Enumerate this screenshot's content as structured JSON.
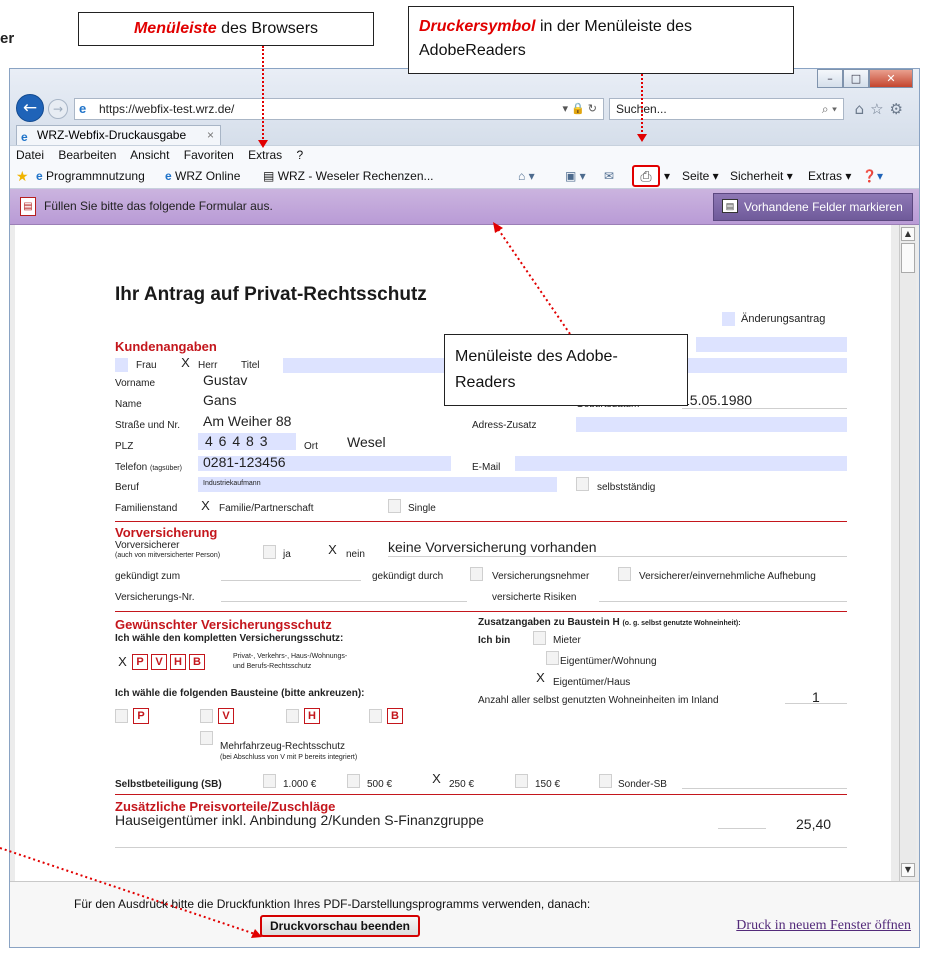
{
  "edge_text": "er",
  "callouts": {
    "browser_menu_em": "Menüleiste",
    "browser_menu_rest": " des Browsers",
    "printer_em": "Druckersymbol",
    "printer_rest": " in der Menüleiste des AdobeReaders",
    "adobe_menu": "Menüleiste des Adobe-Readers"
  },
  "browser": {
    "url": "https://webfix-test.wrz.de/",
    "search_placeholder": "Suchen...",
    "tab_title": "WRZ-Webfix-Druckausgabe",
    "menu": [
      "Datei",
      "Bearbeiten",
      "Ansicht",
      "Favoriten",
      "Extras",
      "?"
    ],
    "favorites": [
      "Programmnutzung",
      "WRZ Online",
      "WRZ - Weseler Rechenzen..."
    ],
    "commands": {
      "seite": "Seite ▾",
      "sicherheit": "Sicherheit ▾",
      "extras": "Extras ▾"
    }
  },
  "adobe": {
    "message": "Füllen Sie bitte das folgende Formular aus.",
    "highlight_button": "Vorhandene Felder markieren"
  },
  "form": {
    "title": "Ihr Antrag auf Privat-Rechtsschutz",
    "aenderungsantrag": "Änderungsantrag",
    "kunden": {
      "heading": "Kundenangaben",
      "frau": "Frau",
      "herr": "Herr",
      "titel": "Titel",
      "vorname_label": "Vorname",
      "vorname": "Gustav",
      "name_label": "Name",
      "name": "Gans",
      "geburtsdatum_label": "Geburtsdatum",
      "geburtsdatum": "15.05.1980",
      "strasse_label": "Straße und Nr.",
      "strasse": "Am Weiher 88",
      "adresszusatz_label": "Adress-Zusatz",
      "plz_label": "PLZ",
      "plz": "4 6 4 8 3",
      "ort_label": "Ort",
      "ort": "Wesel",
      "telefon_label": "Telefon",
      "telefon_suffix": "(tagsüber)",
      "telefon": "0281-123456",
      "email_label": "E-Mail",
      "beruf_label": "Beruf",
      "beruf": "Industriekaufmann",
      "selbststaendig": "selbstständig",
      "familienstand_label": "Familienstand",
      "familie": "Familie/Partnerschaft",
      "single": "Single"
    },
    "vorvers": {
      "heading": "Vorversicherung",
      "vorversicherer": "Vorversicherer",
      "vorversicherer_sub": "(auch von mitversicherter Person)",
      "ja": "ja",
      "nein": "nein",
      "text": "keine Vorversicherung vorhanden",
      "gekuendigt_zum": "gekündigt zum",
      "gekuendigt_durch": "gekündigt durch",
      "versicherungsnehmer": "Versicherungsnehmer",
      "versicherer_aufhebung": "Versicherer/einvernehmliche Aufhebung",
      "versnr": "Versicherungs-Nr.",
      "risiken": "versicherte Risiken"
    },
    "schutz": {
      "heading": "Gewünschter Versicherungsschutz",
      "komplett": "Ich wähle den kompletten Versicherungsschutz:",
      "badges": [
        "P",
        "V",
        "H",
        "B"
      ],
      "komplett_desc1": "Privat-, Verkehrs-, Haus-/Wohnungs-",
      "komplett_desc2": "und Berufs-Rechtsschutz",
      "bausteine": "Ich wähle die folgenden Bausteine (bitte ankreuzen):",
      "mehrfahrzeug": "Mehrfahrzeug-Rechtsschutz",
      "mehrfahrzeug_sub": "(bei Abschluss von V mit P bereits integriert)",
      "zusatz_heading": "Zusatzangaben zu Baustein H",
      "zusatz_sub": "(o. g. selbst genutzte Wohneinheit):",
      "ich_bin": "Ich bin",
      "mieter": "Mieter",
      "eig_wohnung": "Eigentümer/Wohnung",
      "eig_haus": "Eigentümer/Haus",
      "anzahl_label": "Anzahl aller selbst genutzten Wohneinheiten im Inland",
      "anzahl": "1",
      "sb_label": "Selbstbeteiligung (SB)",
      "sb_options": [
        "1.000 €",
        "500 €",
        "250 €",
        "150 €",
        "Sonder-SB"
      ]
    },
    "preis": {
      "heading": "Zusätzliche Preisvorteile/Zuschläge",
      "text": "Hauseigentümer inkl. Anbindung 2/Kunden S-Finanzgruppe",
      "value": "25,40"
    }
  },
  "footer": {
    "text": "Für den Ausdruck bitte die Druckfunktion Ihres PDF-Darstellungsprogramms verwenden, danach:",
    "end_button": "Druckvorschau beenden",
    "new_window_link": "Druck in neuem Fenster öffnen"
  },
  "colors": {
    "accent_red": "#e10000",
    "section_red": "#c4161c",
    "adobe_bar": "#b99bd6",
    "field_blue": "#dde3ff"
  }
}
